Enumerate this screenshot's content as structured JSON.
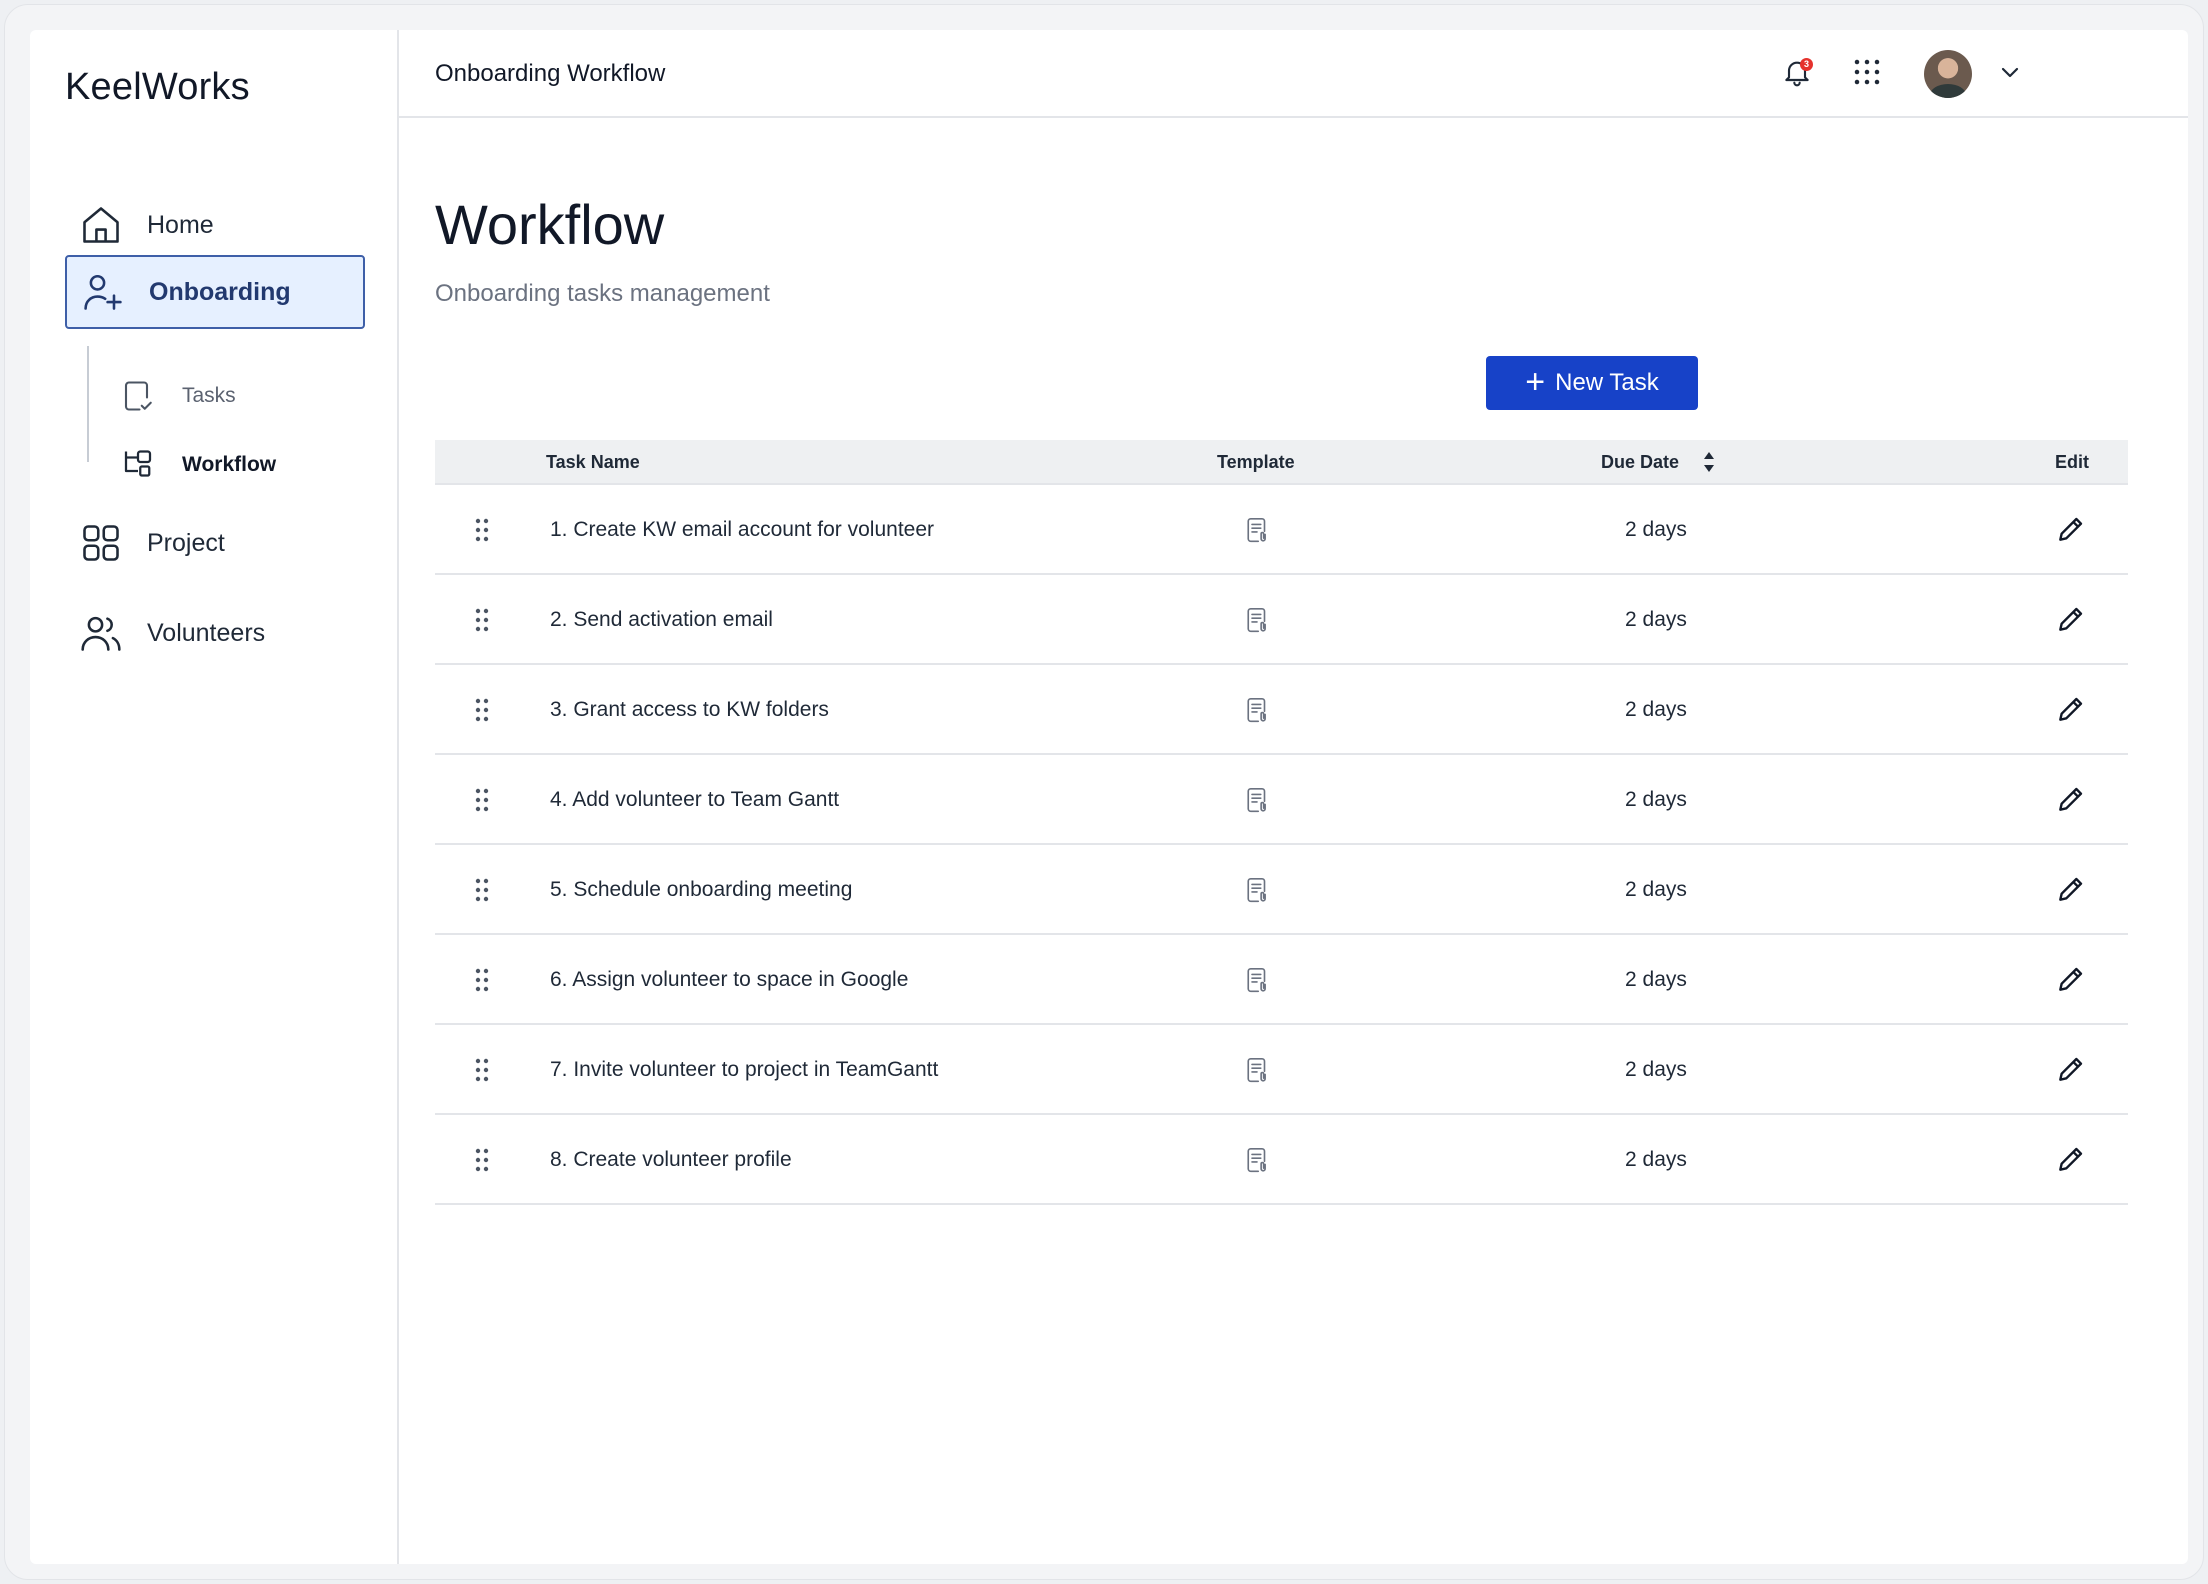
{
  "brand": "KeelWorks",
  "sidebar": {
    "items": [
      {
        "label": "Home",
        "icon": "home-icon"
      },
      {
        "label": "Onboarding",
        "icon": "user-plus-icon"
      },
      {
        "label": "Project",
        "icon": "grid-icon"
      },
      {
        "label": "Volunteers",
        "icon": "users-icon"
      }
    ],
    "sub_items": [
      {
        "label": "Tasks",
        "icon": "task-check-icon"
      },
      {
        "label": "Workflow",
        "icon": "workflow-icon"
      }
    ]
  },
  "topbar": {
    "breadcrumb": "Onboarding Workflow",
    "notification_count": "3"
  },
  "page": {
    "title": "Workflow",
    "subtitle": "Onboarding tasks management",
    "new_task_label": "New Task"
  },
  "table": {
    "headers": {
      "task_name": "Task Name",
      "template": "Template",
      "due_date": "Due Date",
      "edit": "Edit"
    },
    "rows": [
      {
        "name": "1. Create KW email account for volunteer",
        "due": "2 days"
      },
      {
        "name": "2. Send activation email",
        "due": "2 days"
      },
      {
        "name": "3. Grant access to KW folders",
        "due": "2 days"
      },
      {
        "name": "4. Add volunteer to Team Gantt",
        "due": "2 days"
      },
      {
        "name": "5. Schedule onboarding meeting",
        "due": "2 days"
      },
      {
        "name": "6. Assign volunteer to space in Google",
        "due": "2 days"
      },
      {
        "name": "7. Invite volunteer to project in TeamGantt",
        "due": "2 days"
      },
      {
        "name": "8. Create volunteer profile",
        "due": "2 days"
      }
    ]
  },
  "colors": {
    "accent": "#1742c8",
    "active_nav_bg": "#e6f0ff",
    "active_nav_border": "#3e5fa8",
    "badge": "#e5322d"
  }
}
